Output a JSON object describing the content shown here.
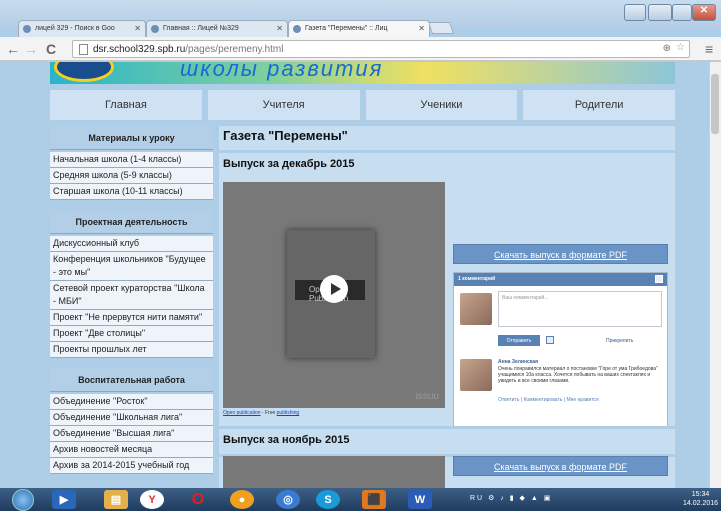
{
  "browser": {
    "tabs": [
      {
        "title": "лицей 329 - Поиск в Goo"
      },
      {
        "title": "Главная :: Лицей №329"
      },
      {
        "title": "Газета \"Перемены\" :: Лиц"
      }
    ],
    "url_host": "dsr.school329.spb.ru",
    "url_path": "/pages/peremeny.html"
  },
  "banner": {
    "text": "школы развития"
  },
  "nav": {
    "items": [
      "Главная",
      "Учителя",
      "Ученики",
      "Родители"
    ]
  },
  "sidebar": {
    "sections": [
      {
        "heading": "Материалы к уроку",
        "items": [
          "Начальная школа (1-4 классы)",
          "Средняя школа (5-9 классы)",
          "Старшая школа (10-11 классы)"
        ]
      },
      {
        "heading": "Проектная деятельность",
        "items": [
          "Дискуссионный клуб",
          "Конференция школьников \"Будущее - это мы\"",
          "Сетевой проект кураторства \"Школа - МБИ\"",
          "Проект \"Не прервутся нити памяти\"",
          "Проект \"Две столицы\"",
          "Проекты прошлых лет"
        ]
      },
      {
        "heading": "Воспитательная работа",
        "items": [
          "Объединение \"Росток\"",
          "Объединение \"Школьная лига\"",
          "Объединение \"Высшая лига\"",
          "Архив новостей месяца",
          "Архив за 2014-2015 учебный год"
        ]
      }
    ]
  },
  "main": {
    "title": "Газета \"Перемены\"",
    "issue1": "Выпуск за декабрь 2015",
    "issue2": "Выпуск за ноябрь 2015",
    "download": "Скачать выпуск в формате PDF",
    "viewer": {
      "brand": "issuu",
      "player_label": "Open Publication"
    },
    "caption": {
      "open": "Open publication",
      "free": " - Free ",
      "publishing": "publishing"
    }
  },
  "comments": {
    "header": "1 комментарий",
    "placeholder": "Ваш комментарий...",
    "submit": "Отправить",
    "publish": "Прикрепить",
    "author": "Анна Зелинская",
    "text": "Очень понравился материал о постановке \"Горе от ума Грибоедова\" учащимися 10а класса. Хочется побывать на ваших спектаклях и увидеть и все своими глазами.",
    "meta": "Ответить | Комментировать | Мне нравится"
  },
  "taskbar": {
    "lang": "RU",
    "time": "15:34",
    "date": "14.02.2016"
  }
}
